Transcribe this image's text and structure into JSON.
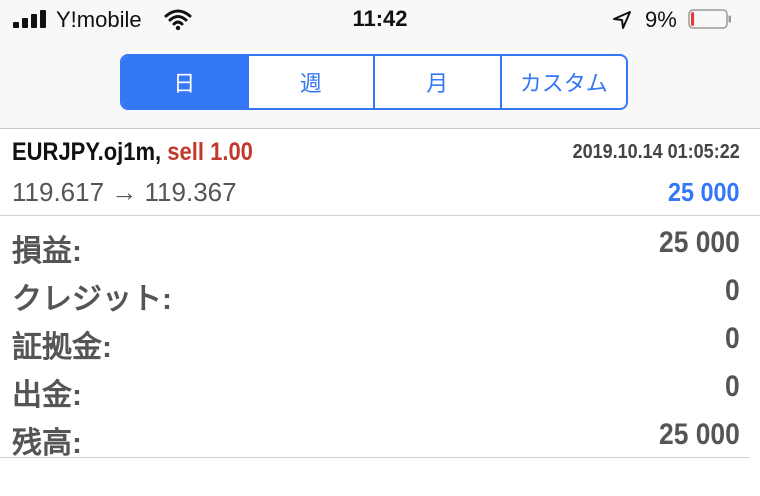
{
  "status_bar": {
    "carrier": "Y!mobile",
    "time": "11:42",
    "battery_percent": "9%",
    "battery_level": 0.09,
    "colors": {
      "battery_low": "#e53935"
    }
  },
  "period_tabs": [
    {
      "label": "日",
      "active": true
    },
    {
      "label": "週",
      "active": false
    },
    {
      "label": "月",
      "active": false
    },
    {
      "label": "カスタム",
      "active": false
    }
  ],
  "trade": {
    "symbol": "EURJPY.oj1m,",
    "side_volume": "sell 1.00",
    "datetime": "2019.10.14 01:05:22",
    "open_price": "119.617",
    "arrow": "→",
    "close_price": "119.367",
    "profit": "25 000"
  },
  "summary": [
    {
      "label": "損益:",
      "value": "25 000"
    },
    {
      "label": "クレジット:",
      "value": "0"
    },
    {
      "label": "証拠金:",
      "value": "0"
    },
    {
      "label": "出金:",
      "value": "0"
    },
    {
      "label": "残高:",
      "value": "25 000"
    }
  ],
  "colors": {
    "accent": "#3478f6",
    "sell": "#c0392b",
    "text": "#555555"
  }
}
